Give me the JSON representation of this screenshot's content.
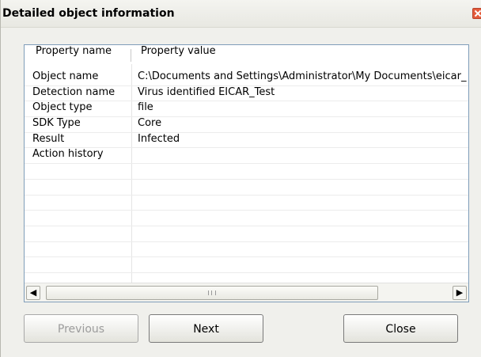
{
  "window": {
    "title": "Detailed object information"
  },
  "grid": {
    "columns": [
      "Property name",
      "Property value"
    ],
    "rows": [
      [
        "Object name",
        "C:\\Documents and Settings\\Administrator\\My Documents\\eicar_"
      ],
      [
        "Detection name",
        "Virus identified EICAR_Test"
      ],
      [
        "Object type",
        "file"
      ],
      [
        "SDK Type",
        "Core"
      ],
      [
        "Result",
        "Infected"
      ],
      [
        "Action history",
        ""
      ],
      [
        "",
        ""
      ],
      [
        "",
        ""
      ],
      [
        "",
        ""
      ],
      [
        "",
        ""
      ],
      [
        "",
        ""
      ],
      [
        "",
        ""
      ],
      [
        "",
        ""
      ],
      [
        "",
        ""
      ]
    ]
  },
  "buttons": {
    "previous": "Previous",
    "next": "Next",
    "close": "Close"
  },
  "icons": {
    "close": "close-icon",
    "scroll_left": "arrow-left-icon",
    "scroll_right": "arrow-right-icon"
  },
  "colors": {
    "close_button": "#e35a3a",
    "grid_border": "#7f9db9"
  }
}
